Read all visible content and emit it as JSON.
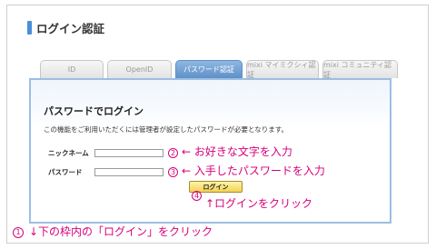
{
  "page": {
    "title": "ログイン認証"
  },
  "tabs": [
    {
      "label": "ID",
      "active": false
    },
    {
      "label": "OpenID",
      "active": false
    },
    {
      "label": "パスワード認証",
      "active": true
    },
    {
      "label": "mixi マイミクシィ認証",
      "active": false
    },
    {
      "label": "mixi コミュニティ認証",
      "active": false
    }
  ],
  "login": {
    "heading": "パスワードでログイン",
    "description": "この機能をご利用いただくには管理者が設定したパスワードが必要となります。",
    "nickname_label": "ニックネーム",
    "nickname_value": "",
    "password_label": "パスワード",
    "password_value": "",
    "button_label": "ログイン"
  },
  "annotations": {
    "step1_num": "1",
    "step1_text": "↓下の枠内の「ログイン」をクリック",
    "step2_num": "2",
    "step2_text": "← お好きな文字を入力",
    "step3_num": "3",
    "step3_text": "← 入手したパスワードを入力",
    "step4_num": "4",
    "step4_text": "↑ログインをクリック"
  },
  "colors": {
    "accent": "#4b8ed8",
    "active_tab": "#6f9ccf",
    "panel_border": "#9bbfe3",
    "annotation": "#d8007a",
    "button": "#f3d253"
  }
}
